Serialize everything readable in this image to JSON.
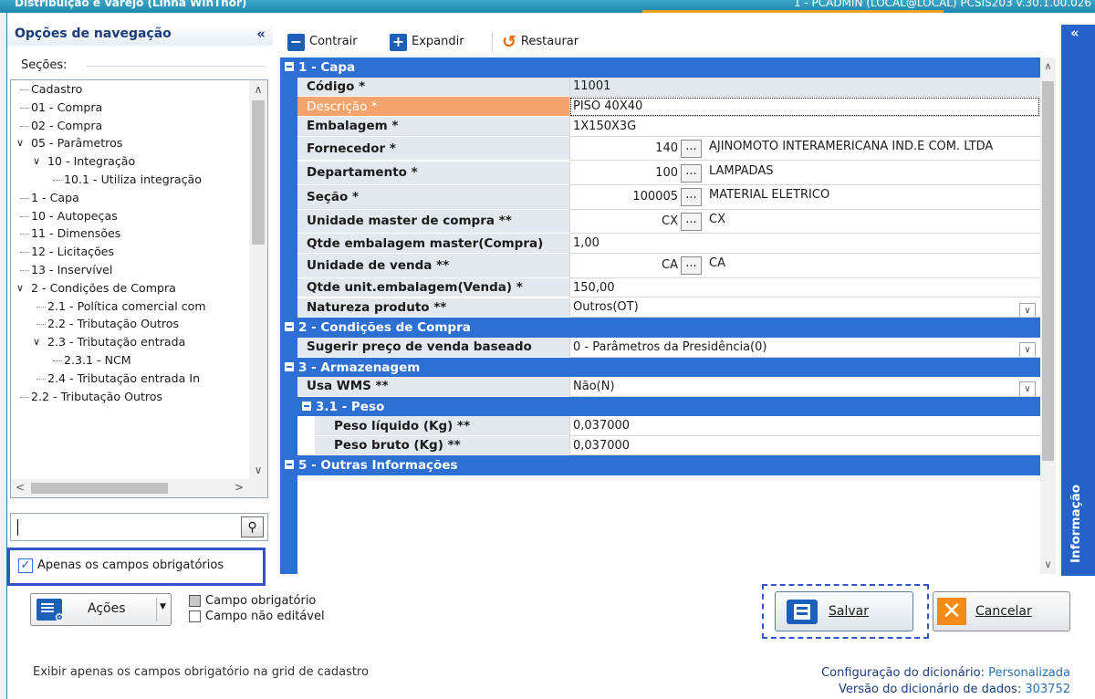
{
  "window": {
    "title": "Distribuição e Varejo (Linha WinThor)",
    "session": "1 - PCADMIN (LOCAL@LOCAL)   PCSIS203  v.30.1.00.026"
  },
  "nav": {
    "title": "Opções de navegação",
    "collapse": "«",
    "sections_label": "Seções:",
    "tree": [
      {
        "label": "Cadastro",
        "indent": 0,
        "expander": ""
      },
      {
        "label": "01 - Compra",
        "indent": 0,
        "expander": ""
      },
      {
        "label": "02 - Compra",
        "indent": 0,
        "expander": ""
      },
      {
        "label": "05 - Parâmetros",
        "indent": 0,
        "expander": "v"
      },
      {
        "label": "10 - Integração",
        "indent": 1,
        "expander": "v"
      },
      {
        "label": "10.1 - Utiliza integração",
        "indent": 2,
        "expander": ""
      },
      {
        "label": "1 - Capa",
        "indent": 0,
        "expander": ""
      },
      {
        "label": "10 - Autopeças",
        "indent": 0,
        "expander": ""
      },
      {
        "label": "11 - Dimensões",
        "indent": 0,
        "expander": ""
      },
      {
        "label": "12 - Licitações",
        "indent": 0,
        "expander": ""
      },
      {
        "label": "13 - Inservível",
        "indent": 0,
        "expander": ""
      },
      {
        "label": "2 - Condições de Compra",
        "indent": 0,
        "expander": "v"
      },
      {
        "label": "2.1 - Política comercial com",
        "indent": 1,
        "expander": ""
      },
      {
        "label": "2.2 - Tributação Outros",
        "indent": 1,
        "expander": ""
      },
      {
        "label": "2.3 - Tributação entrada",
        "indent": 1,
        "expander": "v"
      },
      {
        "label": "2.3.1 - NCM",
        "indent": 2,
        "expander": ""
      },
      {
        "label": "2.4 - Tributação entrada In",
        "indent": 1,
        "expander": ""
      },
      {
        "label": "2.2 - Tributação Outros",
        "indent": 0,
        "expander": ""
      }
    ],
    "search": {
      "value": "",
      "placeholder": ""
    },
    "only_required": {
      "label": "Apenas os campos obrigatórios",
      "checked": true
    }
  },
  "toolbar": {
    "contrair": "Contrair",
    "expandir": "Expandir",
    "restaurar": "Restaurar"
  },
  "grid": {
    "rows": [
      {
        "type": "header",
        "level": 0,
        "label": "1 - Capa"
      },
      {
        "type": "field",
        "label": "Código *",
        "value": "11001",
        "readonly": true
      },
      {
        "type": "field",
        "label": "Descrição *",
        "value": "PISO 40X40",
        "highlight": true,
        "focus": true
      },
      {
        "type": "field",
        "label": "Embalagem *",
        "value": "1X150X3G"
      },
      {
        "type": "lookup",
        "label": "Fornecedor *",
        "code": "140",
        "desc": "AJINOMOTO INTERAMERICANA IND.E COM. LTDA"
      },
      {
        "type": "lookup",
        "label": "Departamento *",
        "code": "100",
        "desc": "LAMPADAS"
      },
      {
        "type": "lookup",
        "label": "Seção *",
        "code": "100005",
        "desc": "MATERIAL ELETRICO"
      },
      {
        "type": "lookup",
        "label": "Unidade master de compra **",
        "code": "CX",
        "desc": "CX"
      },
      {
        "type": "field",
        "label": "Qtde embalagem master(Compra)",
        "value": "1,00"
      },
      {
        "type": "lookup",
        "label": "Unidade de venda **",
        "code": "CA",
        "desc": "CA"
      },
      {
        "type": "field",
        "label": "Qtde unit.embalagem(Venda) *",
        "value": "150,00"
      },
      {
        "type": "select",
        "label": "Natureza produto **",
        "value": "Outros(OT)"
      },
      {
        "type": "header",
        "level": 0,
        "label": "2 - Condições de Compra"
      },
      {
        "type": "select",
        "label": "Sugerir preço de venda baseado",
        "value": "0 - Parâmetros da Presidência(0)"
      },
      {
        "type": "header",
        "level": 0,
        "label": "3 - Armazenagem"
      },
      {
        "type": "select",
        "label": "Usa WMS **",
        "value": "Não(N)"
      },
      {
        "type": "header",
        "level": 1,
        "label": "3.1 - Peso"
      },
      {
        "type": "field",
        "level": 1,
        "label": "Peso líquido (Kg) **",
        "value": "0,037000"
      },
      {
        "type": "field",
        "level": 1,
        "label": "Peso bruto (Kg) **",
        "value": "0,037000"
      },
      {
        "type": "header",
        "level": 0,
        "label": "5 - Outras Informações"
      }
    ]
  },
  "info_panel": {
    "label": "Informação",
    "collapse": "«"
  },
  "bottom": {
    "acoes": "Ações",
    "legend_required": "Campo obrigatório",
    "legend_readonly": "Campo não editável",
    "salvar": "Salvar",
    "cancelar": "Cancelar"
  },
  "status": {
    "hint": "Exibir apenas os campos obrigatório na grid de cadastro",
    "config_label": "Configuração do dicionário:",
    "config_value": "Personalizada",
    "version_label": "Versão do dicionário de dados:",
    "version_value": "303752"
  },
  "colors": {
    "header_blue": "#2d6fd3",
    "highlight_orange": "#f5a36d",
    "focus_border": "#2f55c9"
  }
}
